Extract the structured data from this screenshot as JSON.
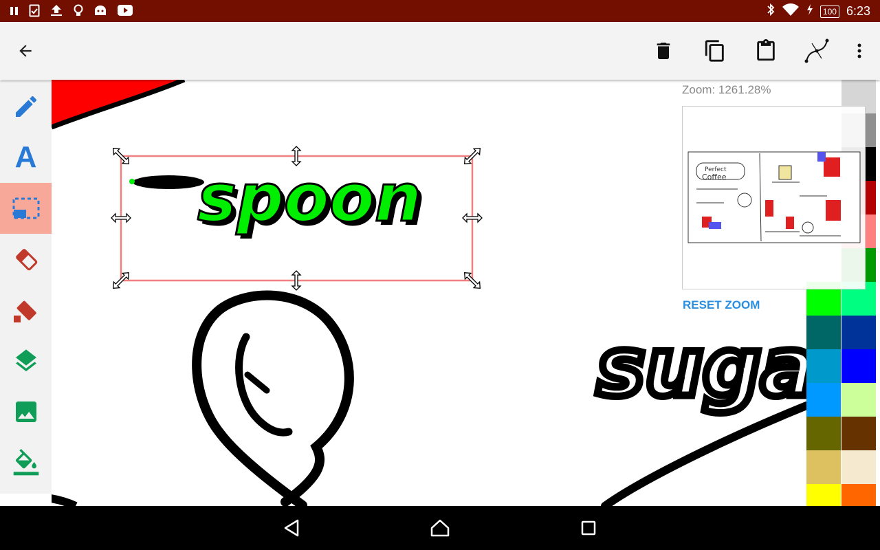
{
  "status_bar": {
    "time": "6:23",
    "battery": "100",
    "left_icons": [
      "pause-icon",
      "clipboard-check-icon",
      "upload-icon",
      "lightbulb-icon",
      "android-icon",
      "youtube-icon"
    ],
    "right_icons": [
      "bluetooth-icon",
      "wifi-icon",
      "charging-icon"
    ]
  },
  "toolbar": {
    "back": "back-arrow-icon",
    "actions": [
      "delete-icon",
      "copy-icon",
      "paste-icon",
      "curve-tool-icon",
      "more-vert-icon"
    ]
  },
  "tools": [
    {
      "name": "pencil-tool",
      "icon": "pencil-icon"
    },
    {
      "name": "text-tool",
      "label": "A",
      "icon": "text-icon"
    },
    {
      "name": "select-tool",
      "icon": "selection-icon",
      "active": true
    },
    {
      "name": "eraser-tool",
      "icon": "eraser-icon"
    },
    {
      "name": "fill-eraser-tool",
      "icon": "eraser-fill-icon"
    },
    {
      "name": "layers-tool",
      "icon": "layers-icon"
    },
    {
      "name": "image-tool",
      "icon": "image-icon"
    },
    {
      "name": "fill-tool",
      "icon": "paint-bucket-icon"
    }
  ],
  "zoom": {
    "label": "Zoom: 1261.28%",
    "reset": "RESET ZOOM"
  },
  "palette": {
    "colors": [
      [
        "#ffffff",
        "#d6d6d6"
      ],
      [
        "#ffffff",
        "#909090"
      ],
      [
        "#ffffff",
        "#000000"
      ],
      [
        "#ffffff",
        "#b30000"
      ],
      [
        "#ffffff",
        "#ff8080"
      ],
      [
        "#ffffff",
        "#009900"
      ],
      [
        "#00ff00",
        "#00ff80"
      ],
      [
        "#006666",
        "#003399"
      ],
      [
        "#0099cc",
        "#0000ff"
      ],
      [
        "#0099ff",
        "#ccff99"
      ],
      [
        "#666600",
        "#663300"
      ],
      [
        "#ddc060",
        "#f5ead0"
      ],
      [
        "#ffff00",
        "#ff6600"
      ]
    ]
  },
  "nav": [
    "back-triangle-icon",
    "home-icon",
    "recents-icon"
  ],
  "accent": "#f8a899",
  "status_color": "#720f00"
}
